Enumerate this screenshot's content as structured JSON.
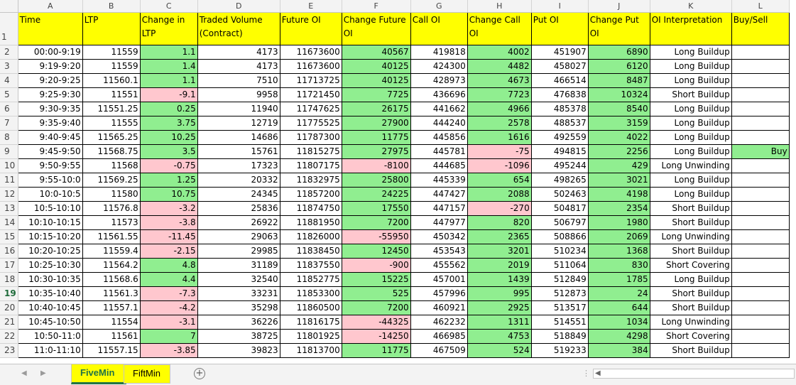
{
  "columns": [
    "A",
    "B",
    "C",
    "D",
    "E",
    "F",
    "G",
    "H",
    "I",
    "J",
    "K",
    "L"
  ],
  "headers": [
    "Time",
    "LTP",
    "Change in LTP",
    "Traded Volume (Contract)",
    "Future OI",
    "Change Future OI",
    "Call OI",
    "Change Call OI",
    "Put OI",
    "Change Put OI",
    "OI Interpretation",
    "Buy/Sell"
  ],
  "header_row_number": "1",
  "active_row_number": "19",
  "rows": [
    {
      "n": "2",
      "time": "00:00-9:19",
      "ltp": "11559",
      "chg": "1.1",
      "vol": "4173",
      "foi": "11673600",
      "cfoi": "40567",
      "coi": "419818",
      "ccoi": "4002",
      "poi": "451907",
      "cpoi": "6890",
      "interp": "Long Buildup",
      "bs": ""
    },
    {
      "n": "3",
      "time": "9:19-9:20",
      "ltp": "11559",
      "chg": "1.4",
      "vol": "4173",
      "foi": "11673600",
      "cfoi": "40125",
      "coi": "424300",
      "ccoi": "4482",
      "poi": "458027",
      "cpoi": "6120",
      "interp": "Long Buildup",
      "bs": ""
    },
    {
      "n": "4",
      "time": "9:20-9:25",
      "ltp": "11560.1",
      "chg": "1.1",
      "vol": "7510",
      "foi": "11713725",
      "cfoi": "40125",
      "coi": "428973",
      "ccoi": "4673",
      "poi": "466514",
      "cpoi": "8487",
      "interp": "Long Buildup",
      "bs": ""
    },
    {
      "n": "5",
      "time": "9:25-9:30",
      "ltp": "11551",
      "chg": "-9.1",
      "vol": "9958",
      "foi": "11721450",
      "cfoi": "7725",
      "coi": "436696",
      "ccoi": "7723",
      "poi": "476838",
      "cpoi": "10324",
      "interp": "Short Buildup",
      "bs": ""
    },
    {
      "n": "6",
      "time": "9:30-9:35",
      "ltp": "11551.25",
      "chg": "0.25",
      "vol": "11940",
      "foi": "11747625",
      "cfoi": "26175",
      "coi": "441662",
      "ccoi": "4966",
      "poi": "485378",
      "cpoi": "8540",
      "interp": "Long Buildup",
      "bs": ""
    },
    {
      "n": "7",
      "time": "9:35-9:40",
      "ltp": "11555",
      "chg": "3.75",
      "vol": "12719",
      "foi": "11775525",
      "cfoi": "27900",
      "coi": "444240",
      "ccoi": "2578",
      "poi": "488537",
      "cpoi": "3159",
      "interp": "Long Buildup",
      "bs": ""
    },
    {
      "n": "8",
      "time": "9:40-9:45",
      "ltp": "11565.25",
      "chg": "10.25",
      "vol": "14686",
      "foi": "11787300",
      "cfoi": "11775",
      "coi": "445856",
      "ccoi": "1616",
      "poi": "492559",
      "cpoi": "4022",
      "interp": "Long Buildup",
      "bs": ""
    },
    {
      "n": "9",
      "time": "9:45-9:50",
      "ltp": "11568.75",
      "chg": "3.5",
      "vol": "15761",
      "foi": "11815275",
      "cfoi": "27975",
      "coi": "445781",
      "ccoi": "-75",
      "poi": "494815",
      "cpoi": "2256",
      "interp": "Long Buildup",
      "bs": "Buy"
    },
    {
      "n": "10",
      "time": "9:50-9:55",
      "ltp": "11568",
      "chg": "-0.75",
      "vol": "17323",
      "foi": "11807175",
      "cfoi": "-8100",
      "coi": "444685",
      "ccoi": "-1096",
      "poi": "495244",
      "cpoi": "429",
      "interp": "Long Unwinding",
      "bs": ""
    },
    {
      "n": "11",
      "time": "9:55-10:0",
      "ltp": "11569.25",
      "chg": "1.25",
      "vol": "20332",
      "foi": "11832975",
      "cfoi": "25800",
      "coi": "445339",
      "ccoi": "654",
      "poi": "498265",
      "cpoi": "3021",
      "interp": "Long Buildup",
      "bs": ""
    },
    {
      "n": "12",
      "time": "10:0-10:5",
      "ltp": "11580",
      "chg": "10.75",
      "vol": "24345",
      "foi": "11857200",
      "cfoi": "24225",
      "coi": "447427",
      "ccoi": "2088",
      "poi": "502463",
      "cpoi": "4198",
      "interp": "Long Buildup",
      "bs": ""
    },
    {
      "n": "13",
      "time": "10:5-10:10",
      "ltp": "11576.8",
      "chg": "-3.2",
      "vol": "25836",
      "foi": "11874750",
      "cfoi": "17550",
      "coi": "447157",
      "ccoi": "-270",
      "poi": "504817",
      "cpoi": "2354",
      "interp": "Short Buildup",
      "bs": ""
    },
    {
      "n": "14",
      "time": "10:10-10:15",
      "ltp": "11573",
      "chg": "-3.8",
      "vol": "26922",
      "foi": "11881950",
      "cfoi": "7200",
      "coi": "447977",
      "ccoi": "820",
      "poi": "506797",
      "cpoi": "1980",
      "interp": "Short Buildup",
      "bs": ""
    },
    {
      "n": "15",
      "time": "10:15-10:20",
      "ltp": "11561.55",
      "chg": "-11.45",
      "vol": "29063",
      "foi": "11826000",
      "cfoi": "-55950",
      "coi": "450342",
      "ccoi": "2365",
      "poi": "508866",
      "cpoi": "2069",
      "interp": "Long Unwinding",
      "bs": ""
    },
    {
      "n": "16",
      "time": "10:20-10:25",
      "ltp": "11559.4",
      "chg": "-2.15",
      "vol": "29985",
      "foi": "11838450",
      "cfoi": "12450",
      "coi": "453543",
      "ccoi": "3201",
      "poi": "510234",
      "cpoi": "1368",
      "interp": "Short Buildup",
      "bs": ""
    },
    {
      "n": "17",
      "time": "10:25-10:30",
      "ltp": "11564.2",
      "chg": "4.8",
      "vol": "31189",
      "foi": "11837550",
      "cfoi": "-900",
      "coi": "455562",
      "ccoi": "2019",
      "poi": "511064",
      "cpoi": "830",
      "interp": "Short Covering",
      "bs": ""
    },
    {
      "n": "18",
      "time": "10:30-10:35",
      "ltp": "11568.6",
      "chg": "4.4",
      "vol": "32540",
      "foi": "11852775",
      "cfoi": "15225",
      "coi": "457001",
      "ccoi": "1439",
      "poi": "512849",
      "cpoi": "1785",
      "interp": "Long Buildup",
      "bs": ""
    },
    {
      "n": "19",
      "time": "10:35-10:40",
      "ltp": "11561.3",
      "chg": "-7.3",
      "vol": "33231",
      "foi": "11853300",
      "cfoi": "525",
      "coi": "457996",
      "ccoi": "995",
      "poi": "512873",
      "cpoi": "24",
      "interp": "Short Buildup",
      "bs": ""
    },
    {
      "n": "20",
      "time": "10:40-10:45",
      "ltp": "11557.1",
      "chg": "-4.2",
      "vol": "35298",
      "foi": "11860500",
      "cfoi": "7200",
      "coi": "460921",
      "ccoi": "2925",
      "poi": "513517",
      "cpoi": "644",
      "interp": "Short Buildup",
      "bs": ""
    },
    {
      "n": "21",
      "time": "10:45-10:50",
      "ltp": "11554",
      "chg": "-3.1",
      "vol": "36226",
      "foi": "11816175",
      "cfoi": "-44325",
      "coi": "462232",
      "ccoi": "1311",
      "poi": "514551",
      "cpoi": "1034",
      "interp": "Long Unwinding",
      "bs": ""
    },
    {
      "n": "22",
      "time": "10:50-11:0",
      "ltp": "11561",
      "chg": "7",
      "vol": "38725",
      "foi": "11801925",
      "cfoi": "-14250",
      "coi": "466985",
      "ccoi": "4753",
      "poi": "518849",
      "cpoi": "4298",
      "interp": "Short Covering",
      "bs": ""
    },
    {
      "n": "23",
      "time": "11:0-11:10",
      "ltp": "11557.15",
      "chg": "-3.85",
      "vol": "39823",
      "foi": "11813700",
      "cfoi": "11775",
      "coi": "467509",
      "ccoi": "524",
      "poi": "519233",
      "cpoi": "384",
      "interp": "Short Buildup",
      "bs": ""
    }
  ],
  "tabs": {
    "active": "FiveMin",
    "other": "FiftMin"
  },
  "colors": {
    "positive": "#90ee90",
    "negative": "#ffc7ce",
    "header": "#ffff00",
    "active_tab_text": "#217346"
  }
}
